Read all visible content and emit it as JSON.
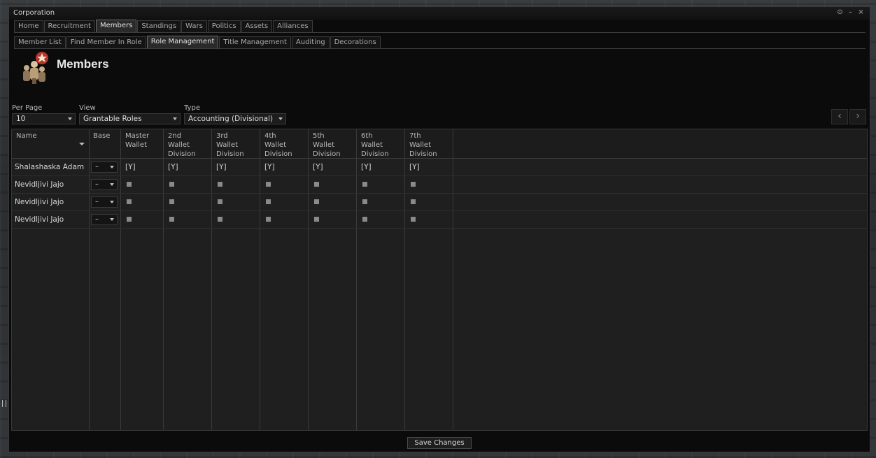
{
  "window": {
    "title": "Corporation"
  },
  "window_buttons": [
    "⊙",
    "–",
    "×"
  ],
  "main_tabs": [
    "Home",
    "Recruitment",
    "Members",
    "Standings",
    "Wars",
    "Politics",
    "Assets",
    "Alliances"
  ],
  "main_tab_active": "Members",
  "sub_tabs": [
    "Member List",
    "Find Member In Role",
    "Role Management",
    "Title Management",
    "Auditing",
    "Decorations"
  ],
  "sub_tab_active": "Role Management",
  "page": {
    "title": "Members",
    "icon": "members-icon"
  },
  "filters": {
    "per_page": {
      "label": "Per Page",
      "value": "10"
    },
    "view": {
      "label": "View",
      "value": "Grantable Roles"
    },
    "type": {
      "label": "Type",
      "value": "Accounting (Divisional)"
    }
  },
  "pager": {
    "prev": "‹",
    "next": "›"
  },
  "table": {
    "columns": [
      "Name",
      "Base",
      "Master\nWallet",
      "2nd\nWallet\nDivision",
      "3rd\nWallet\nDivision",
      "4th\nWallet\nDivision",
      "5th\nWallet\nDivision",
      "6th\nWallet\nDivision",
      "7th\nWallet\nDivision"
    ],
    "rows": [
      {
        "name": "Shalashaska Adam",
        "base": "–",
        "cells": [
          "[Y]",
          "[Y]",
          "[Y]",
          "[Y]",
          "[Y]",
          "[Y]",
          "[Y]"
        ]
      },
      {
        "name": "Nevidljivi Jajo",
        "base": "–",
        "cells": [
          "check",
          "check",
          "check",
          "check",
          "check",
          "check",
          "check"
        ]
      },
      {
        "name": "Nevidljivi Jajo",
        "base": "–",
        "cells": [
          "check",
          "check",
          "check",
          "check",
          "check",
          "check",
          "check"
        ]
      },
      {
        "name": "Nevidljivi Jajo",
        "base": "–",
        "cells": [
          "check",
          "check",
          "check",
          "check",
          "check",
          "check",
          "check"
        ]
      }
    ]
  },
  "save_button": "Save Changes"
}
